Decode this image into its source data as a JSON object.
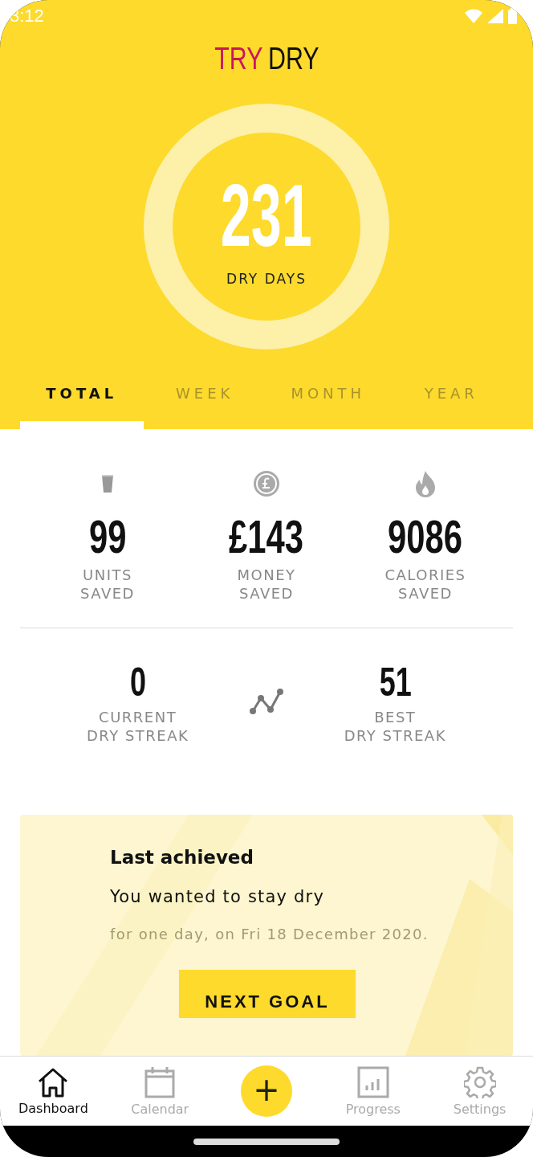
{
  "status_bar": {
    "time": "3:12"
  },
  "logo": {
    "first": "TRY",
    "second": "DRY"
  },
  "counter": {
    "value": "231",
    "label": "DRY DAYS"
  },
  "tabs": [
    {
      "label": "TOTAL",
      "selected": true
    },
    {
      "label": "WEEK",
      "selected": false
    },
    {
      "label": "MONTH",
      "selected": false
    },
    {
      "label": "YEAR",
      "selected": false
    }
  ],
  "stats": [
    {
      "kind": "glass",
      "value": "99",
      "label": "UNITS\nSAVED"
    },
    {
      "kind": "coin",
      "value": "£143",
      "label": "MONEY\nSAVED"
    },
    {
      "kind": "flame",
      "value": "9086",
      "label": "CALORIES\nSAVED"
    }
  ],
  "streaks": [
    {
      "value": "0",
      "label": "CURRENT\nDRY STREAK"
    },
    {
      "value": "51",
      "label": "BEST\nDRY STREAK"
    }
  ],
  "card": {
    "title": "Last achieved",
    "subtitle": "You wanted to stay dry",
    "detail": "for one day, on Fri 18 December 2020.",
    "button": "NEXT GOAL"
  },
  "nav": [
    {
      "kind": "home",
      "label": "Dashboard",
      "selected": true
    },
    {
      "kind": "calendar",
      "label": "Calendar",
      "selected": false
    },
    {
      "kind": "add",
      "label": "+",
      "selected": false
    },
    {
      "kind": "chart",
      "label": "Progress",
      "selected": false
    },
    {
      "kind": "gear",
      "label": "Settings",
      "selected": false
    }
  ]
}
